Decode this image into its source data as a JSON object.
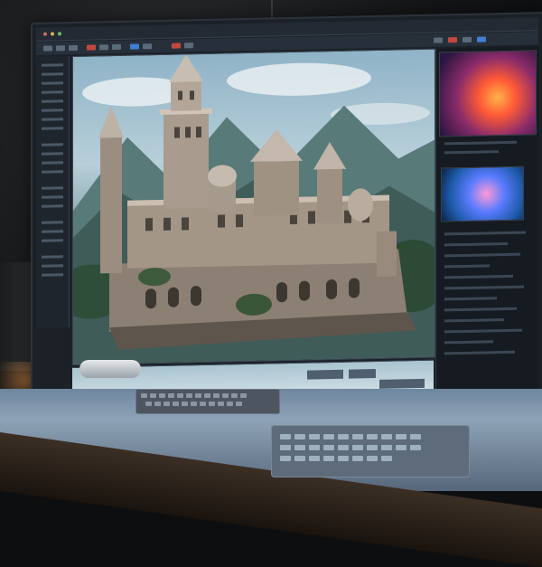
{
  "scene": {
    "icons": {
      "studio": "dark-room",
      "monitor": "widescreen-monitor",
      "castle": "castle-illustration",
      "fire_preview": "fire-render-thumb",
      "blue_preview": "nebula-render-thumb",
      "keyboard": "keyboard",
      "keypad": "control-keypad",
      "desk": "desk"
    },
    "colors": {
      "sky": "#b8cfd9",
      "ui_dark": "#1c2128",
      "accent_red": "#c4473d",
      "accent_blue": "#3f7fd1"
    }
  }
}
